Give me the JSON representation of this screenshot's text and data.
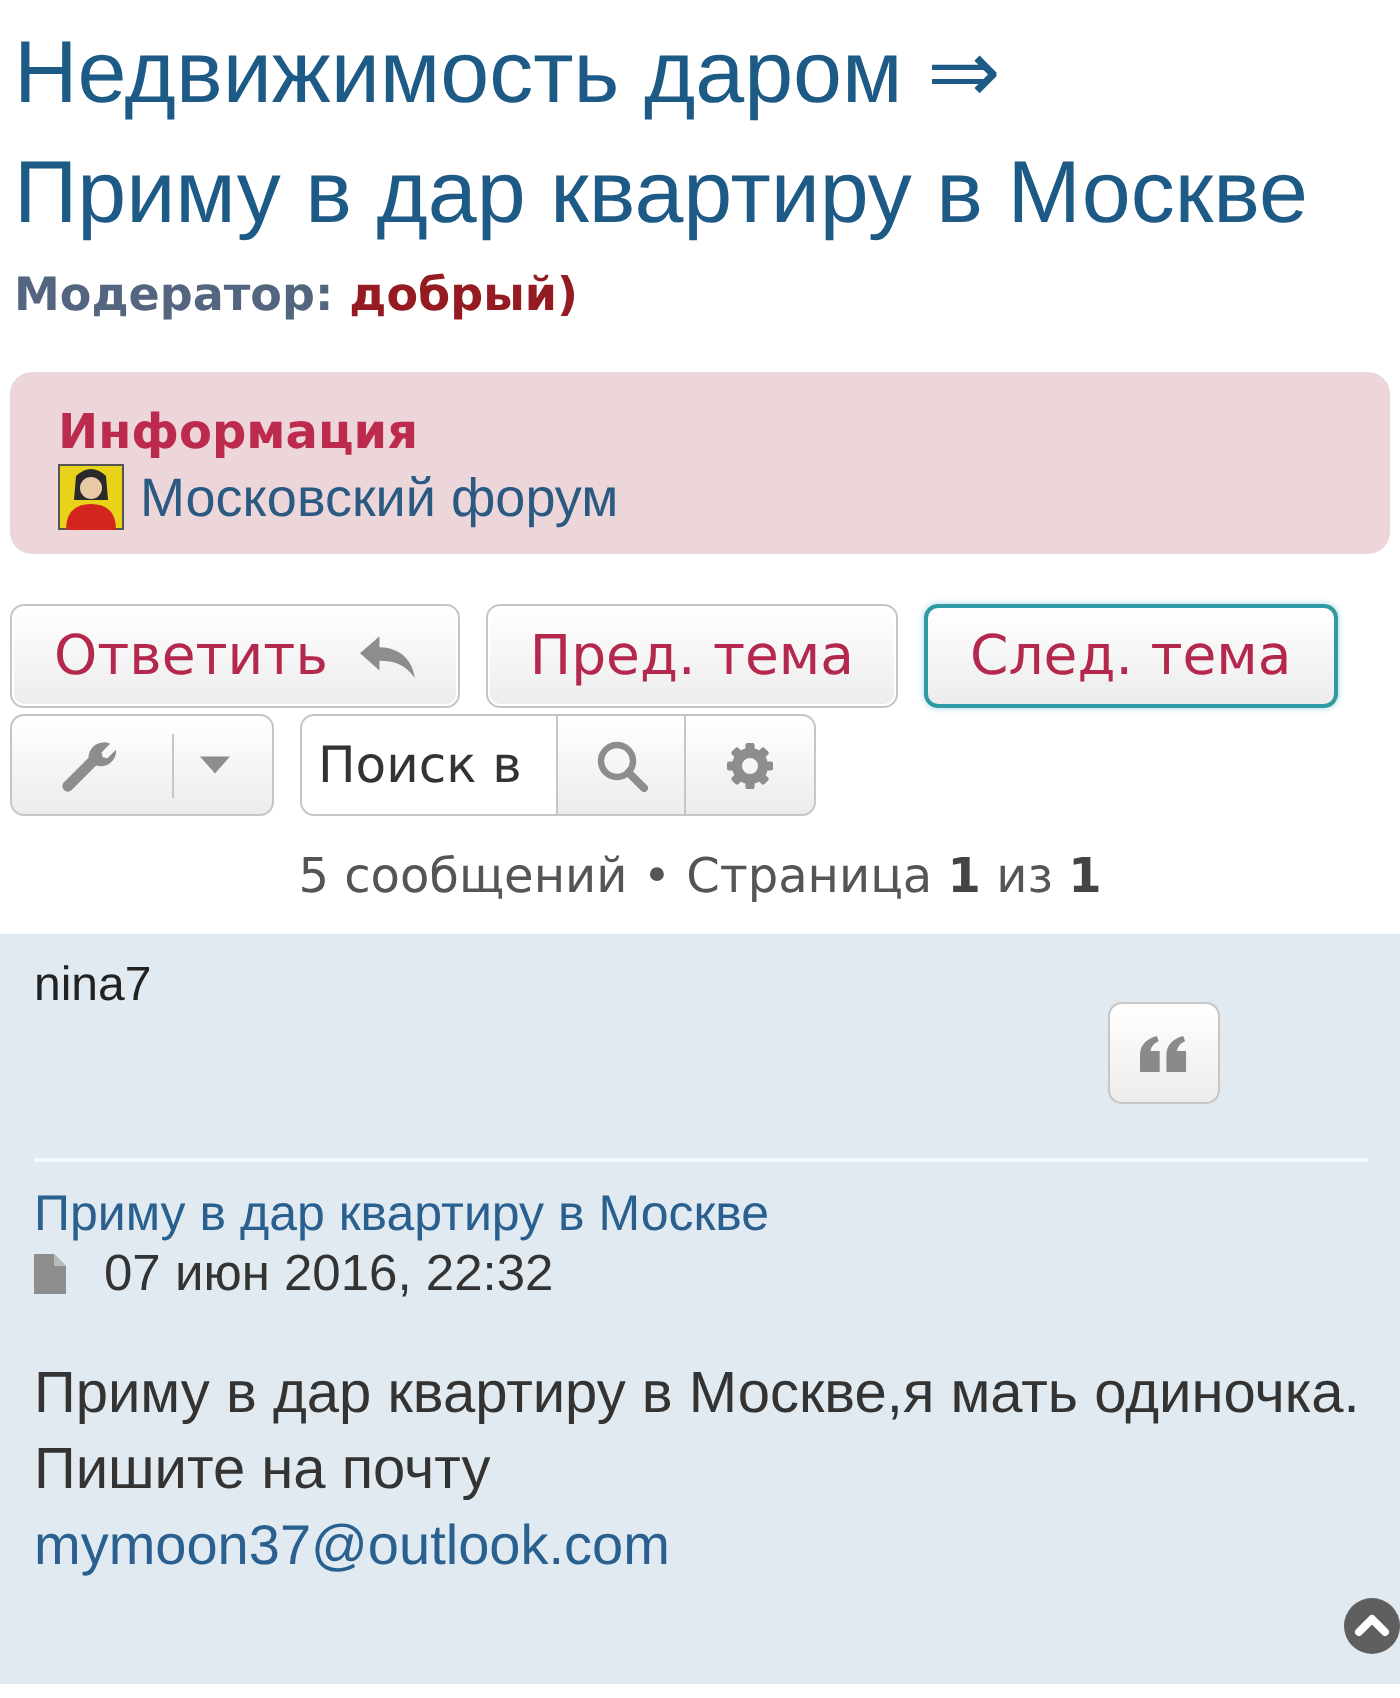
{
  "header": {
    "forum_link": "Недвижимость даром ⇒",
    "topic_title": "Приму в дар квартиру в Москве",
    "moderator_label": "Модератор:",
    "moderator_name": "добрый)"
  },
  "info_panel": {
    "heading": "Информация",
    "forum_link": "Московский форум"
  },
  "action_buttons": [
    {
      "label": "Ответить",
      "kind": "reply",
      "focused": false
    },
    {
      "label": "Пред. тема",
      "kind": "plain",
      "focused": false
    },
    {
      "label": "След. тема",
      "kind": "plain",
      "focused": true
    }
  ],
  "search": {
    "placeholder": "Поиск в"
  },
  "pagination": "5 сообщений • Страница **1** из **1**",
  "post": {
    "author": "nina7",
    "title": "Приму в дар квартиру в Москве",
    "date": "07 июн 2016, 22:32",
    "body_lines": [
      "Приму в дар квартиру в Москве,я мать одиночка.",
      "Пишите на почту"
    ],
    "email": "mymoon37@outlook.com"
  }
}
